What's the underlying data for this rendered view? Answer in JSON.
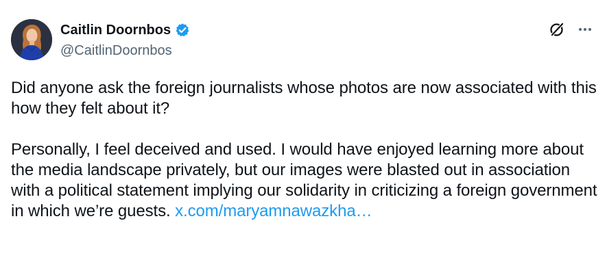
{
  "tweet": {
    "author": {
      "display_name": "Caitlin Doornbos",
      "handle": "@CaitlinDoornbos",
      "verified": true
    },
    "text": {
      "paragraph_1": "Did anyone ask the foreign journalists whose photos are now associated with this how they felt about it?",
      "paragraph_2": "Personally, I feel deceived and used. I would have enjoyed learning more about the media landscape privately, but our images were blasted out in association with a political statement implying our solidarity in criticizing a foreign government in which we’re guests.",
      "link_text": "x.com/maryamnawazkha…"
    },
    "icons": {
      "verified": "verified-badge-icon",
      "grok": "grok-icon",
      "more": "more-options-icon"
    },
    "colors": {
      "link": "#1d9bf0",
      "verified": "#1d9bf0",
      "handle": "#536471",
      "text": "#0f1419"
    }
  }
}
